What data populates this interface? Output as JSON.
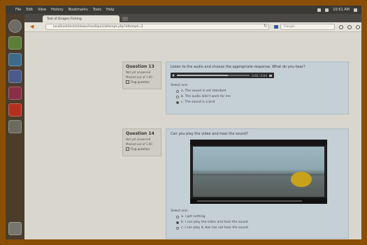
{
  "top_panel": {
    "menu": [
      "File",
      "Edit",
      "View",
      "History",
      "Bookmarks",
      "Tools",
      "Help"
    ],
    "clock": "10:51 AM"
  },
  "launcher": {
    "items": [
      "dash-home",
      "files",
      "browser",
      "text-editor",
      "calculator",
      "software-center",
      "workspaces",
      "trash"
    ]
  },
  "browser": {
    "tab_title": "Test of Dragon Fishing",
    "url": "localhost/test/sitdown/mod/quiz/attempt.php?attempt=3",
    "search_placeholder": "Google"
  },
  "questions": [
    {
      "number": "Question 13",
      "status": "Not yet answered",
      "marks": "Marked out of 1.00",
      "flag_label": "Flag question",
      "text": "Listen to the audio and choose the appropriate response. What do you hear?",
      "player_time": "0:00 / 0:04",
      "progress": 0.7,
      "select_label": "Select one:",
      "options": [
        {
          "label": "a. The sound is not standard",
          "checked": false
        },
        {
          "label": "b. The audio didn't work for me",
          "checked": false
        },
        {
          "label": "c. The sound is a bird",
          "checked": true
        }
      ]
    },
    {
      "number": "Question 14",
      "status": "Not yet answered",
      "marks": "Marked out of 1.00",
      "flag_label": "Flag question",
      "text": "Can you play the video and hear the sound?",
      "select_label": "Select one:",
      "options": [
        {
          "label": "a. I get nothing",
          "checked": false
        },
        {
          "label": "b. I can play the video and hear the sound",
          "checked": true
        },
        {
          "label": "c. I can play it, but can not hear the sound",
          "checked": false
        }
      ]
    }
  ]
}
